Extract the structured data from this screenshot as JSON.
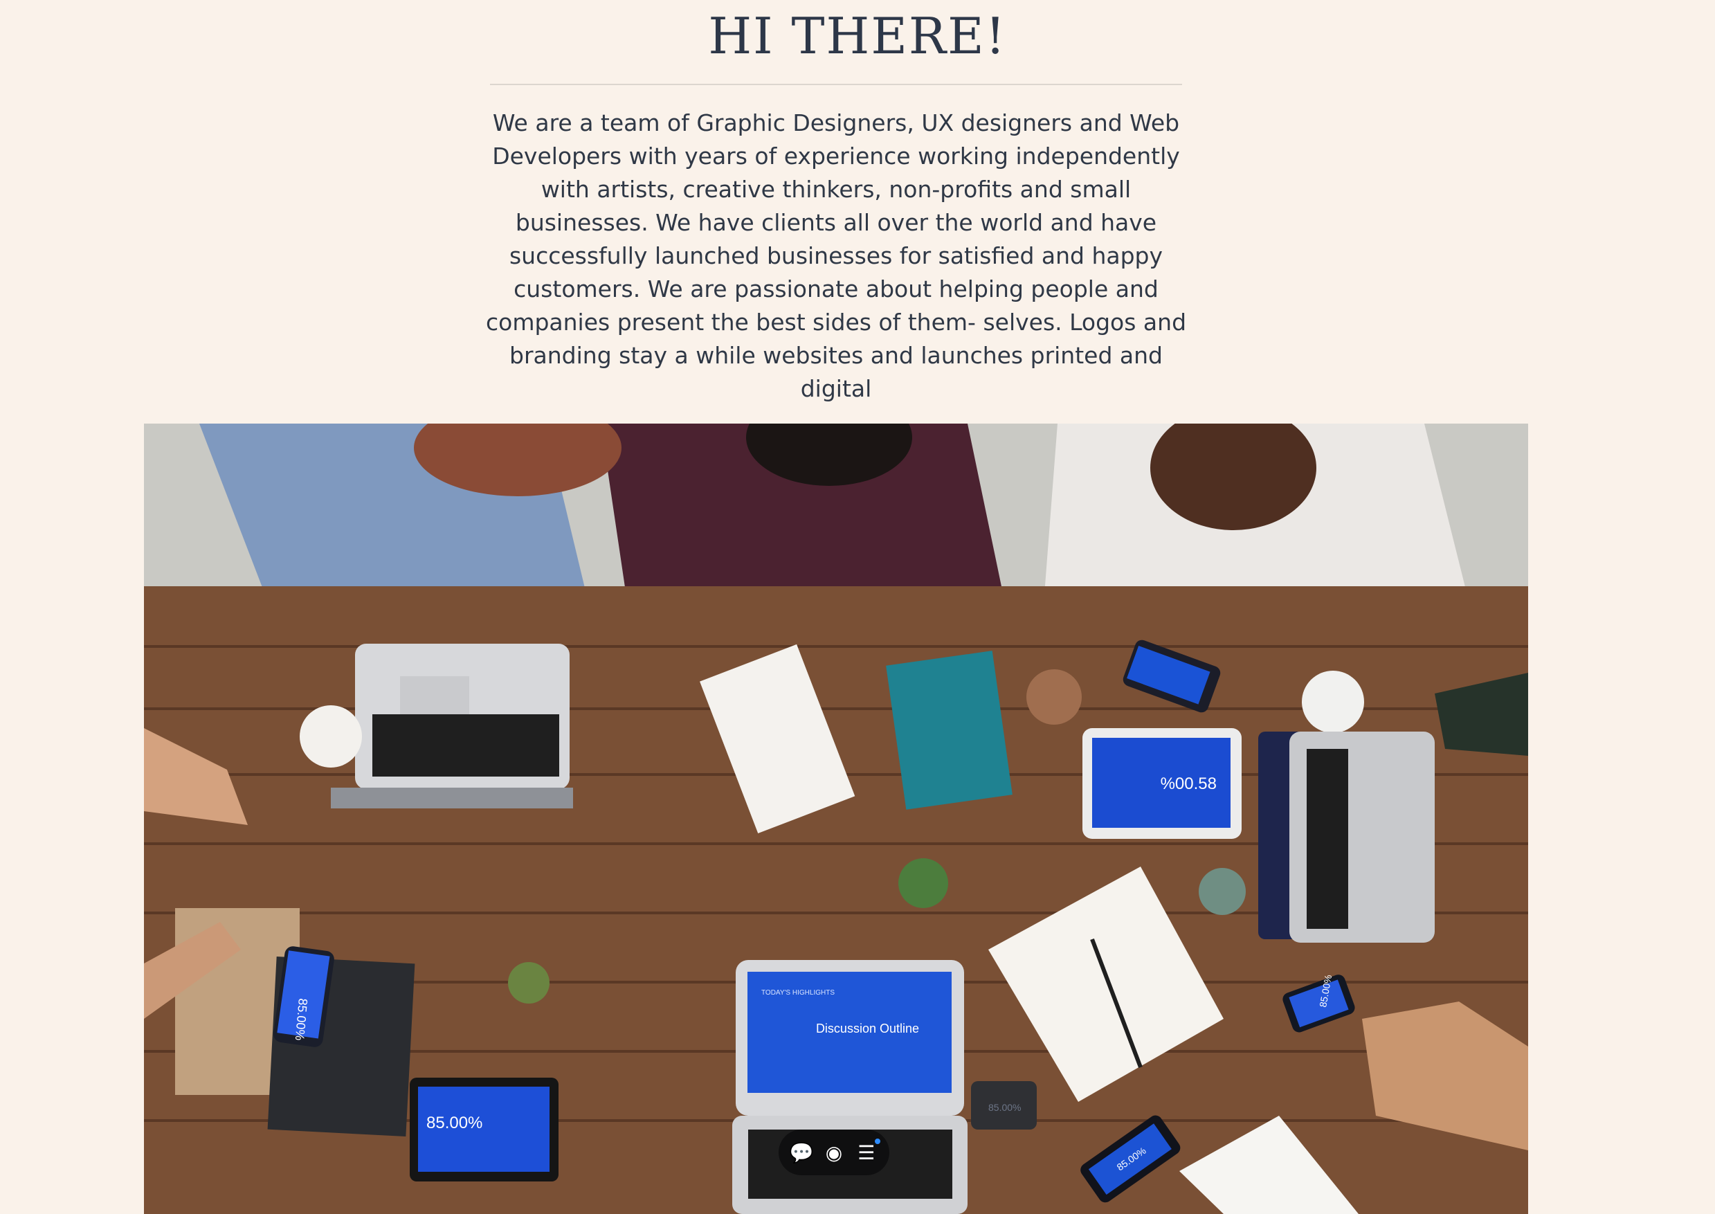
{
  "hero_section": {
    "title": "HI THERE!",
    "intro": "We are a team of Graphic Designers, UX designers and Web Developers with years of experience working independently with artists, creative thinkers, non-profits and small businesses. We have clients all over the world and have successfully launched businesses for satisfied and happy customers. We are passionate about helping people and companies present the best sides of them- selves. Logos and branding stay a while websites and launches printed and digital"
  },
  "hero_image": {
    "screens": {
      "left_phone": "85.00%",
      "bottom_tablet": "85.00%",
      "center_laptop_title": "Discussion Outline",
      "center_laptop_header": "TODAY'S HIGHLIGHTS",
      "right_tablet": "%00.58",
      "right_phone": "85.00%",
      "bottom_phone": "85.00%",
      "small_device": "85.00%"
    }
  },
  "floating_toolbar": {
    "comment_icon": "chat-bubble",
    "view_icon": "eye",
    "menu_icon": "menu"
  },
  "colors": {
    "background": "#faf2ea",
    "text": "#2f3846",
    "divider": "#dcd6cf",
    "toolbar": "#0f0f10",
    "accent_dot": "#2d8cff"
  }
}
